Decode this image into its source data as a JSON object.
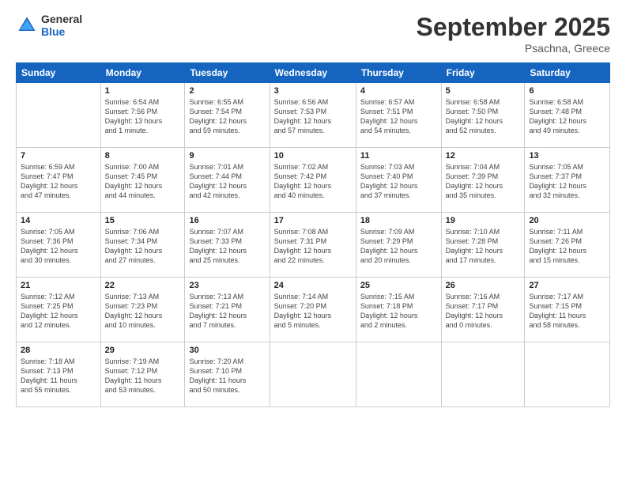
{
  "header": {
    "logo_line1": "General",
    "logo_line2": "Blue",
    "month": "September 2025",
    "location": "Psachna, Greece"
  },
  "weekdays": [
    "Sunday",
    "Monday",
    "Tuesday",
    "Wednesday",
    "Thursday",
    "Friday",
    "Saturday"
  ],
  "weeks": [
    [
      {
        "day": "",
        "info": ""
      },
      {
        "day": "1",
        "info": "Sunrise: 6:54 AM\nSunset: 7:56 PM\nDaylight: 13 hours\nand 1 minute."
      },
      {
        "day": "2",
        "info": "Sunrise: 6:55 AM\nSunset: 7:54 PM\nDaylight: 12 hours\nand 59 minutes."
      },
      {
        "day": "3",
        "info": "Sunrise: 6:56 AM\nSunset: 7:53 PM\nDaylight: 12 hours\nand 57 minutes."
      },
      {
        "day": "4",
        "info": "Sunrise: 6:57 AM\nSunset: 7:51 PM\nDaylight: 12 hours\nand 54 minutes."
      },
      {
        "day": "5",
        "info": "Sunrise: 6:58 AM\nSunset: 7:50 PM\nDaylight: 12 hours\nand 52 minutes."
      },
      {
        "day": "6",
        "info": "Sunrise: 6:58 AM\nSunset: 7:48 PM\nDaylight: 12 hours\nand 49 minutes."
      }
    ],
    [
      {
        "day": "7",
        "info": "Sunrise: 6:59 AM\nSunset: 7:47 PM\nDaylight: 12 hours\nand 47 minutes."
      },
      {
        "day": "8",
        "info": "Sunrise: 7:00 AM\nSunset: 7:45 PM\nDaylight: 12 hours\nand 44 minutes."
      },
      {
        "day": "9",
        "info": "Sunrise: 7:01 AM\nSunset: 7:44 PM\nDaylight: 12 hours\nand 42 minutes."
      },
      {
        "day": "10",
        "info": "Sunrise: 7:02 AM\nSunset: 7:42 PM\nDaylight: 12 hours\nand 40 minutes."
      },
      {
        "day": "11",
        "info": "Sunrise: 7:03 AM\nSunset: 7:40 PM\nDaylight: 12 hours\nand 37 minutes."
      },
      {
        "day": "12",
        "info": "Sunrise: 7:04 AM\nSunset: 7:39 PM\nDaylight: 12 hours\nand 35 minutes."
      },
      {
        "day": "13",
        "info": "Sunrise: 7:05 AM\nSunset: 7:37 PM\nDaylight: 12 hours\nand 32 minutes."
      }
    ],
    [
      {
        "day": "14",
        "info": "Sunrise: 7:05 AM\nSunset: 7:36 PM\nDaylight: 12 hours\nand 30 minutes."
      },
      {
        "day": "15",
        "info": "Sunrise: 7:06 AM\nSunset: 7:34 PM\nDaylight: 12 hours\nand 27 minutes."
      },
      {
        "day": "16",
        "info": "Sunrise: 7:07 AM\nSunset: 7:33 PM\nDaylight: 12 hours\nand 25 minutes."
      },
      {
        "day": "17",
        "info": "Sunrise: 7:08 AM\nSunset: 7:31 PM\nDaylight: 12 hours\nand 22 minutes."
      },
      {
        "day": "18",
        "info": "Sunrise: 7:09 AM\nSunset: 7:29 PM\nDaylight: 12 hours\nand 20 minutes."
      },
      {
        "day": "19",
        "info": "Sunrise: 7:10 AM\nSunset: 7:28 PM\nDaylight: 12 hours\nand 17 minutes."
      },
      {
        "day": "20",
        "info": "Sunrise: 7:11 AM\nSunset: 7:26 PM\nDaylight: 12 hours\nand 15 minutes."
      }
    ],
    [
      {
        "day": "21",
        "info": "Sunrise: 7:12 AM\nSunset: 7:25 PM\nDaylight: 12 hours\nand 12 minutes."
      },
      {
        "day": "22",
        "info": "Sunrise: 7:13 AM\nSunset: 7:23 PM\nDaylight: 12 hours\nand 10 minutes."
      },
      {
        "day": "23",
        "info": "Sunrise: 7:13 AM\nSunset: 7:21 PM\nDaylight: 12 hours\nand 7 minutes."
      },
      {
        "day": "24",
        "info": "Sunrise: 7:14 AM\nSunset: 7:20 PM\nDaylight: 12 hours\nand 5 minutes."
      },
      {
        "day": "25",
        "info": "Sunrise: 7:15 AM\nSunset: 7:18 PM\nDaylight: 12 hours\nand 2 minutes."
      },
      {
        "day": "26",
        "info": "Sunrise: 7:16 AM\nSunset: 7:17 PM\nDaylight: 12 hours\nand 0 minutes."
      },
      {
        "day": "27",
        "info": "Sunrise: 7:17 AM\nSunset: 7:15 PM\nDaylight: 11 hours\nand 58 minutes."
      }
    ],
    [
      {
        "day": "28",
        "info": "Sunrise: 7:18 AM\nSunset: 7:13 PM\nDaylight: 11 hours\nand 55 minutes."
      },
      {
        "day": "29",
        "info": "Sunrise: 7:19 AM\nSunset: 7:12 PM\nDaylight: 11 hours\nand 53 minutes."
      },
      {
        "day": "30",
        "info": "Sunrise: 7:20 AM\nSunset: 7:10 PM\nDaylight: 11 hours\nand 50 minutes."
      },
      {
        "day": "",
        "info": ""
      },
      {
        "day": "",
        "info": ""
      },
      {
        "day": "",
        "info": ""
      },
      {
        "day": "",
        "info": ""
      }
    ]
  ]
}
